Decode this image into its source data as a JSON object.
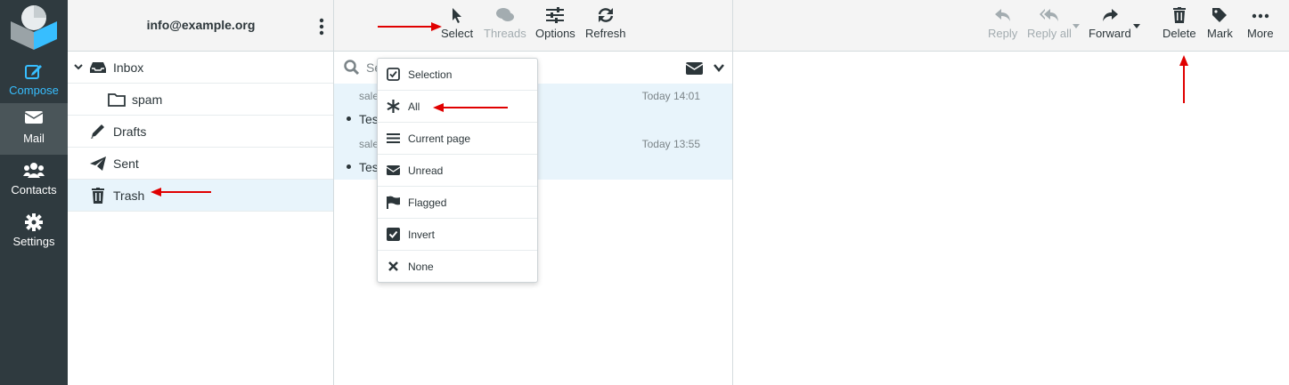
{
  "nav": {
    "items": [
      {
        "label": "Compose",
        "icon": "compose-icon"
      },
      {
        "label": "Mail",
        "icon": "envelope-icon"
      },
      {
        "label": "Contacts",
        "icon": "users-icon"
      },
      {
        "label": "Settings",
        "icon": "gear-icon"
      }
    ]
  },
  "folders": {
    "account": "info@example.org",
    "items": [
      {
        "label": "Inbox",
        "icon": "inbox-icon"
      },
      {
        "label": "spam",
        "icon": "folder-icon"
      },
      {
        "label": "Drafts",
        "icon": "pencil-icon"
      },
      {
        "label": "Sent",
        "icon": "paper-plane-icon"
      },
      {
        "label": "Trash",
        "icon": "trash-icon"
      }
    ]
  },
  "list_toolbar": {
    "select": "Select",
    "threads": "Threads",
    "options": "Options",
    "refresh": "Refresh"
  },
  "search": {
    "placeholder": "Se"
  },
  "messages": [
    {
      "from": "sale",
      "date": "Today 14:01",
      "subject": "Tes"
    },
    {
      "from": "sale",
      "date": "Today 13:55",
      "subject": "Tes"
    }
  ],
  "select_menu": {
    "items": [
      {
        "label": "Selection",
        "icon": "checkbox-outline-icon"
      },
      {
        "label": "All",
        "icon": "asterisk-icon"
      },
      {
        "label": "Current page",
        "icon": "list-icon"
      },
      {
        "label": "Unread",
        "icon": "envelope-icon"
      },
      {
        "label": "Flagged",
        "icon": "flag-icon"
      },
      {
        "label": "Invert",
        "icon": "checkbox-checked-icon"
      },
      {
        "label": "None",
        "icon": "x-icon"
      }
    ]
  },
  "message_toolbar": {
    "reply": "Reply",
    "reply_all": "Reply all",
    "forward": "Forward",
    "delete": "Delete",
    "mark": "Mark",
    "more": "More"
  },
  "colors": {
    "nav_bg": "#2f3a3f",
    "accent": "#37beff",
    "selected_row": "#e8f4fb",
    "annotation_arrow": "#e00000"
  }
}
